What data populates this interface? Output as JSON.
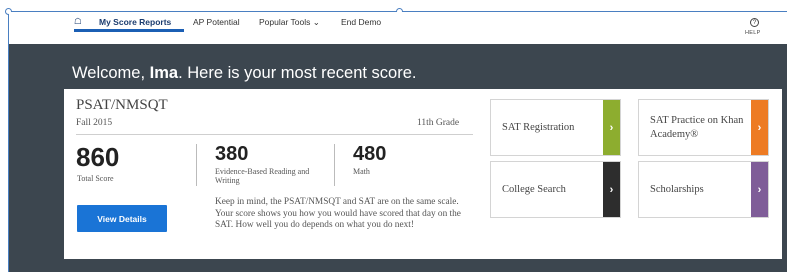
{
  "nav": {
    "items": [
      {
        "label": "My Score Reports",
        "active": true
      },
      {
        "label": "AP Potential"
      },
      {
        "label": "Popular Tools ⌄"
      },
      {
        "label": "End Demo"
      }
    ],
    "help_label": "HELP",
    "home_icon": "home-icon",
    "help_icon": "question-circle-icon"
  },
  "welcome": {
    "prefix": "Welcome, ",
    "name": "Ima",
    "suffix": ". Here is your most recent score."
  },
  "score_report": {
    "exam": "PSAT/NMSQT",
    "term": "Fall 2015",
    "grade": "11th Grade",
    "total_score": "860",
    "total_label": "Total Score",
    "ebrw_score": "380",
    "ebrw_label": "Evidence-Based Reading and Writing",
    "math_score": "480",
    "math_label": "Math",
    "view_details_label": "View Details",
    "note": "Keep in mind, the PSAT/NMSQT and SAT are on the same scale. Your score shows you how you would have scored that day on the SAT. How well you do depends on what you do next!"
  },
  "cards": [
    {
      "label": "SAT Registration",
      "color": "#8dad2f",
      "arrow": "›"
    },
    {
      "label": "SAT Practice on Khan Academy®",
      "color": "#ed7b24",
      "arrow": "›"
    },
    {
      "label": "College Search",
      "color": "#2d2d2d",
      "arrow": "›"
    },
    {
      "label": "Scholarships",
      "color": "#7f5d98",
      "arrow": "›"
    }
  ],
  "colors": {
    "band": "#3c464f",
    "accent": "#1a74d6",
    "nav_text": "#1a3b6e"
  }
}
